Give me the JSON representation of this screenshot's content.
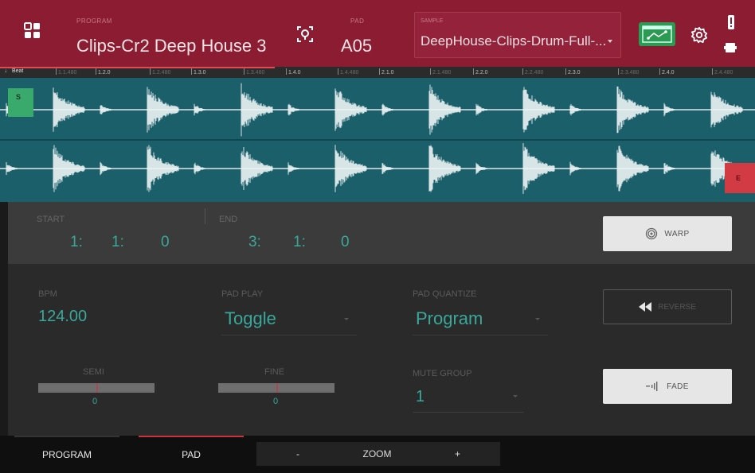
{
  "header": {
    "program_label": "PROGRAM",
    "program_name": "Clips-Cr2 Deep House 3",
    "pad_label": "PAD",
    "pad_value": "A05",
    "sample_label": "SAMPLE",
    "sample_value": "DeepHouse-Clips-Drum-Full-...",
    "icons": [
      "grid-icon",
      "locate-pad-icon",
      "sample-edit-icon",
      "gear-icon",
      "warning-icon",
      "battery-icon"
    ]
  },
  "ruler": {
    "beat_label": "♩ Beat",
    "ticks": [
      "1.1.480",
      "1.2.0",
      "1.2.480",
      "1.3.0",
      "1.3.480",
      "1.4.0",
      "1.4.480",
      "2.1.0",
      "2.1.480",
      "2.2.0",
      "2.2.480",
      "2.3.0",
      "2.3.480",
      "2.4.0",
      "2.4.480"
    ]
  },
  "markers": {
    "start": "S",
    "end": "E"
  },
  "start_end": {
    "start_label": "START",
    "start_values": [
      "1:",
      "1:",
      "0"
    ],
    "end_label": "END",
    "end_values": [
      "3:",
      "1:",
      "0"
    ]
  },
  "buttons": {
    "warp": "WARP",
    "reverse": "REVERSE",
    "fade": "FADE"
  },
  "params": {
    "bpm_label": "BPM",
    "bpm_value": "124.00",
    "pad_play_label": "PAD PLAY",
    "pad_play_value": "Toggle",
    "pad_quantize_label": "PAD QUANTIZE",
    "pad_quantize_value": "Program",
    "semi_label": "SEMI",
    "semi_value": "0",
    "fine_label": "FINE",
    "fine_value": "0",
    "mute_group_label": "MUTE GROUP",
    "mute_group_value": "1"
  },
  "bottom": {
    "tab_program": "PROGRAM",
    "tab_pad": "PAD",
    "zoom_label": "ZOOM",
    "zoom_minus": "-",
    "zoom_plus": "+"
  },
  "colors": {
    "header": "#8c1c31",
    "waveform_bg": "#1b5f6b",
    "accent_teal": "#3aa79b",
    "start_marker": "#3aa96c",
    "end_marker": "#d23a44",
    "tab_active": "#c8333e"
  }
}
